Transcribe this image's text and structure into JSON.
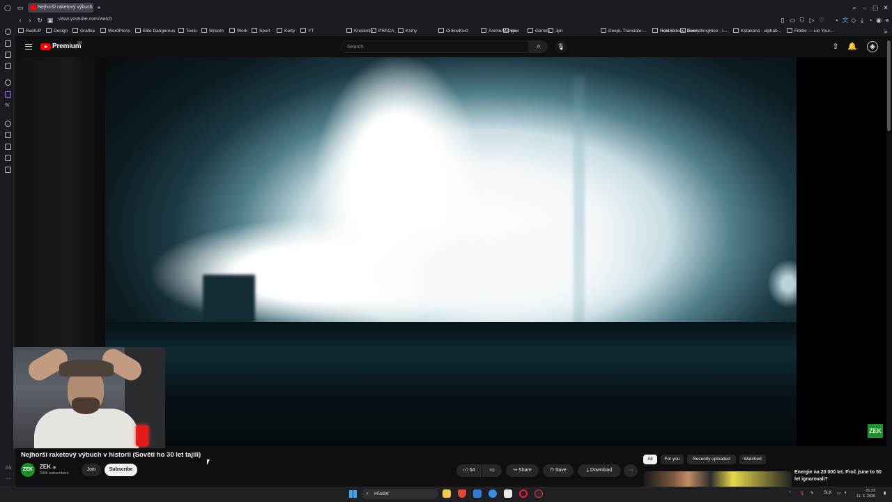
{
  "browser": {
    "tab_title": "Nejhorší raketový výbuch",
    "url": "www.youtube.com/watch",
    "bookmarks": [
      "RastUP",
      "Design",
      "Grafika",
      "WordPress",
      "Elite Dangerous",
      "Tools",
      "Stream",
      "Work",
      "Sport",
      "Karty",
      "YT",
      "Kreslenie",
      "PRACA",
      "Knihy",
      "OnlineKurz",
      "Anime/Manga",
      "kmx",
      "Games",
      "Jpn",
      "DeepL Translate:...",
      "Reel Videos, Down...",
      "Hokuro",
      "EverythingMoe - I...",
      "Katakana - alphab...",
      "Fibble — Lie Your..."
    ]
  },
  "header": {
    "logo_text": "Premium",
    "region": "SK",
    "search_placeholder": "Search"
  },
  "video": {
    "title": "Nejhorší raketový výbuch v historii (Sověti ho 30 let tajili)",
    "watermark": "ZEK"
  },
  "channel": {
    "avatar_text": "ZEK",
    "name": "ZEK",
    "subscribers": "340k subscribers",
    "join_label": "Join",
    "subscribe_label": "Subscribe"
  },
  "actions": {
    "likes": "64",
    "share_label": "Share",
    "save_label": "Save",
    "download_label": "Download",
    "more_label": "···"
  },
  "chips": [
    "All",
    "For you",
    "Recently uploaded",
    "Watched"
  ],
  "recommendation": {
    "title": "Energie na 20 000 let. Proč jsme to 50 let ignorovali?"
  },
  "rail": {
    "gx": "GX",
    "more": "···"
  },
  "taskbar": {
    "search_label": "Hľadať",
    "lang": "SLK",
    "time": "21:23",
    "date": "11. 6. 2026"
  },
  "colors": {
    "background": "#0f0f0f",
    "yt_red": "#ff0000",
    "chip_active": "#f1f1f1",
    "channel_green": "#1e8f2c"
  }
}
